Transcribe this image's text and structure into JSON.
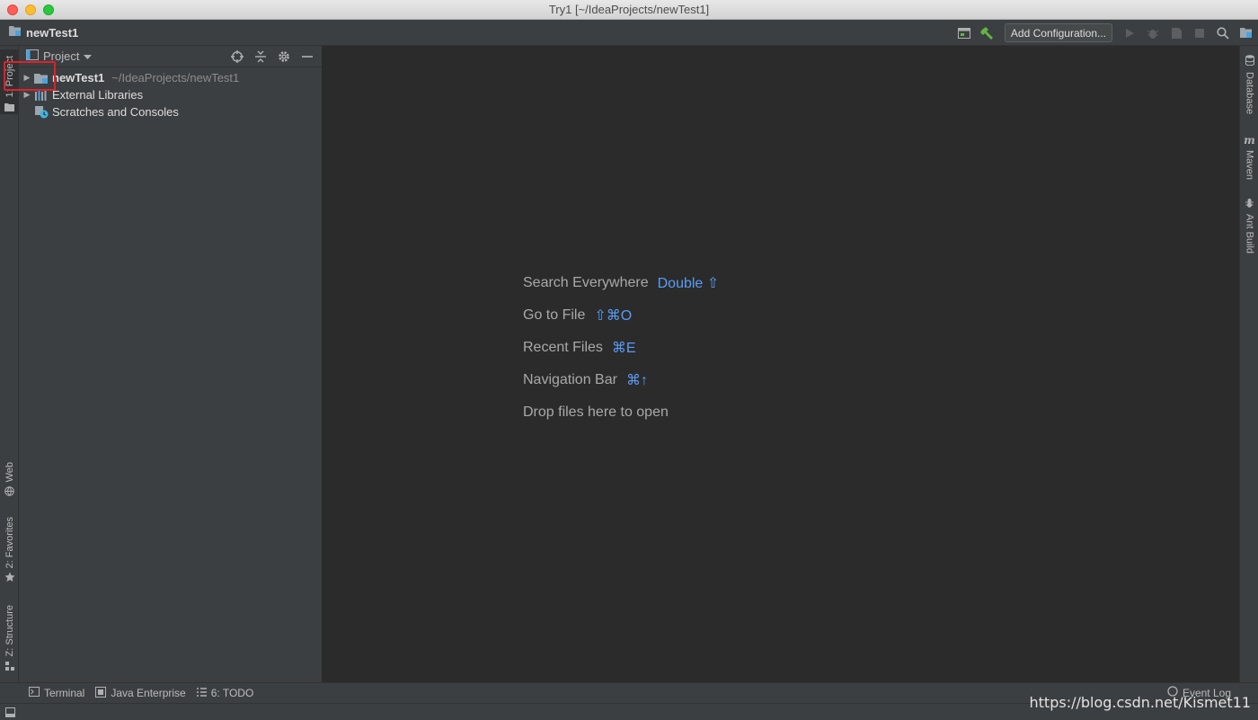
{
  "window": {
    "title": "Try1 [~/IdeaProjects/newTest1]"
  },
  "navbar": {
    "project_name": "newTest1"
  },
  "toolbar": {
    "add_configuration": "Add Configuration..."
  },
  "project_panel": {
    "title": "Project"
  },
  "tree": [
    {
      "name": "newTest1",
      "path": "~/IdeaProjects/newTest1"
    },
    {
      "name": "External Libraries"
    },
    {
      "name": "Scratches and Consoles"
    }
  ],
  "left_tool_tabs": {
    "project": "1: Project",
    "web": "Web",
    "favorites": "2: Favorites",
    "structure": "Z: Structure"
  },
  "right_tool_tabs": {
    "database": "Database",
    "maven": "Maven",
    "ant": "Ant Build"
  },
  "editor_hints": [
    {
      "label": "Search Everywhere",
      "shortcut": "Double ⇧"
    },
    {
      "label": "Go to File",
      "shortcut": "⇧⌘O"
    },
    {
      "label": "Recent Files",
      "shortcut": "⌘E"
    },
    {
      "label": "Navigation Bar",
      "shortcut": "⌘↑"
    },
    {
      "label": "Drop files here to open",
      "shortcut": ""
    }
  ],
  "bottom_tabs": {
    "terminal": "Terminal",
    "java_enterprise": "Java Enterprise",
    "todo": "6: TODO",
    "event_log": "Event Log"
  },
  "watermark": "https://blog.csdn.net/Kismet11",
  "colors": {
    "accent": "#589df6",
    "highlight": "#e0202a",
    "background": "#2b2b2b",
    "panel": "#3c3f41"
  }
}
